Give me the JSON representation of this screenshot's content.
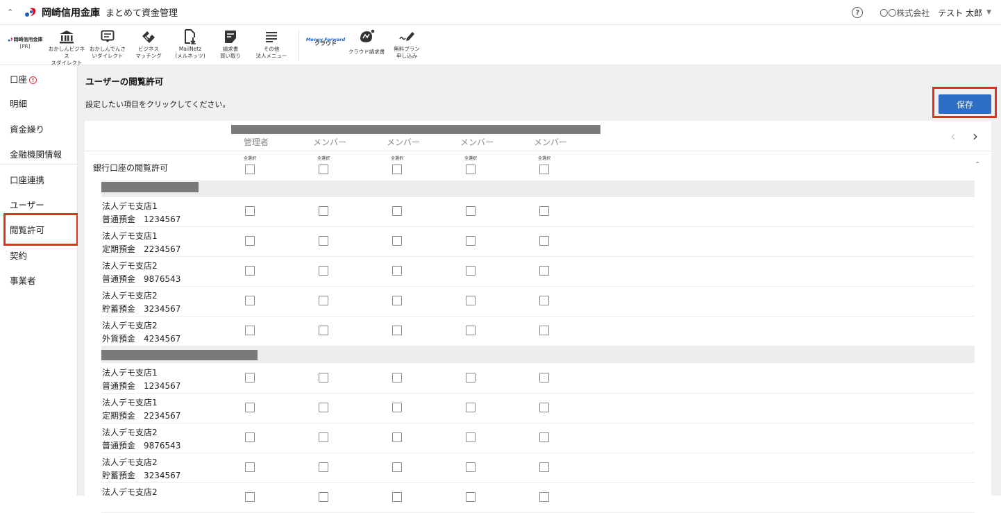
{
  "header": {
    "bank_name": "岡崎信用金庫",
    "app_name": "まとめて資金管理",
    "company": "〇〇株式会社",
    "user": "テスト 太郎"
  },
  "toolbar": {
    "pr_bank": "岡崎信用金庫",
    "pr_tag": "[PR]",
    "items": [
      {
        "label": "おかしんビジネス\nスダイレクト",
        "icon": "bank-icon"
      },
      {
        "label": "おかしんでんさ\nいダイレクト",
        "icon": "monitor-icon"
      },
      {
        "label": "ビジネス\nマッチング",
        "icon": "handshake-icon"
      },
      {
        "label": "MailNetz\n(メルネッツ)",
        "icon": "document-download-icon"
      },
      {
        "label": "請求書\n買い取り",
        "icon": "invoice-icon"
      },
      {
        "label": "その他\n法人メニュー",
        "icon": "menu-list-icon"
      },
      {
        "label": "クラウド",
        "icon": "moneyforward-logo",
        "brand": "Money Forward"
      },
      {
        "label": "クラウド請求書",
        "icon": "cloud-invoice-icon"
      },
      {
        "label": "無料プラン\n申し込み",
        "icon": "pen-sign-icon"
      }
    ]
  },
  "sidebar": {
    "items": [
      {
        "label": "口座",
        "alert": "!"
      },
      {
        "label": "明細"
      },
      {
        "label": "資金繰り"
      },
      {
        "label": "金融機関情報"
      },
      {
        "label": "口座連携"
      },
      {
        "label": "ユーザー"
      },
      {
        "label": "閲覧許可"
      },
      {
        "label": "契約"
      },
      {
        "label": "事業者"
      }
    ]
  },
  "main": {
    "title": "ユーザーの閲覧許可",
    "instruction": "設定したい項目をクリックしてください。",
    "save_label": "保存",
    "columns": [
      "管理者",
      "メンバー",
      "メンバー",
      "メンバー",
      "メンバー"
    ],
    "select_all_label": "全選択",
    "section_label": "銀行口座の閲覧許可",
    "groups": [
      {
        "accounts": [
          {
            "branch": "法人デモ支店1",
            "account": "普通預金　1234567"
          },
          {
            "branch": "法人デモ支店1",
            "account": "定期預金　2234567"
          },
          {
            "branch": "法人デモ支店2",
            "account": "普通預金　9876543"
          },
          {
            "branch": "法人デモ支店2",
            "account": "貯蓄預金　3234567"
          },
          {
            "branch": "法人デモ支店2",
            "account": "外貨預金　4234567"
          }
        ]
      },
      {
        "accounts": [
          {
            "branch": "法人デモ支店1",
            "account": "普通預金　1234567"
          },
          {
            "branch": "法人デモ支店1",
            "account": "定期預金　2234567"
          },
          {
            "branch": "法人デモ支店2",
            "account": "普通預金　9876543"
          },
          {
            "branch": "法人デモ支店2",
            "account": "貯蓄預金　3234567"
          },
          {
            "branch": "法人デモ支店2",
            "account": ""
          }
        ]
      }
    ]
  },
  "colors": {
    "accent": "#2d6ec4",
    "highlight": "#e0321f",
    "brand_red": "#e60012",
    "brand_blue": "#1f5fb8"
  }
}
